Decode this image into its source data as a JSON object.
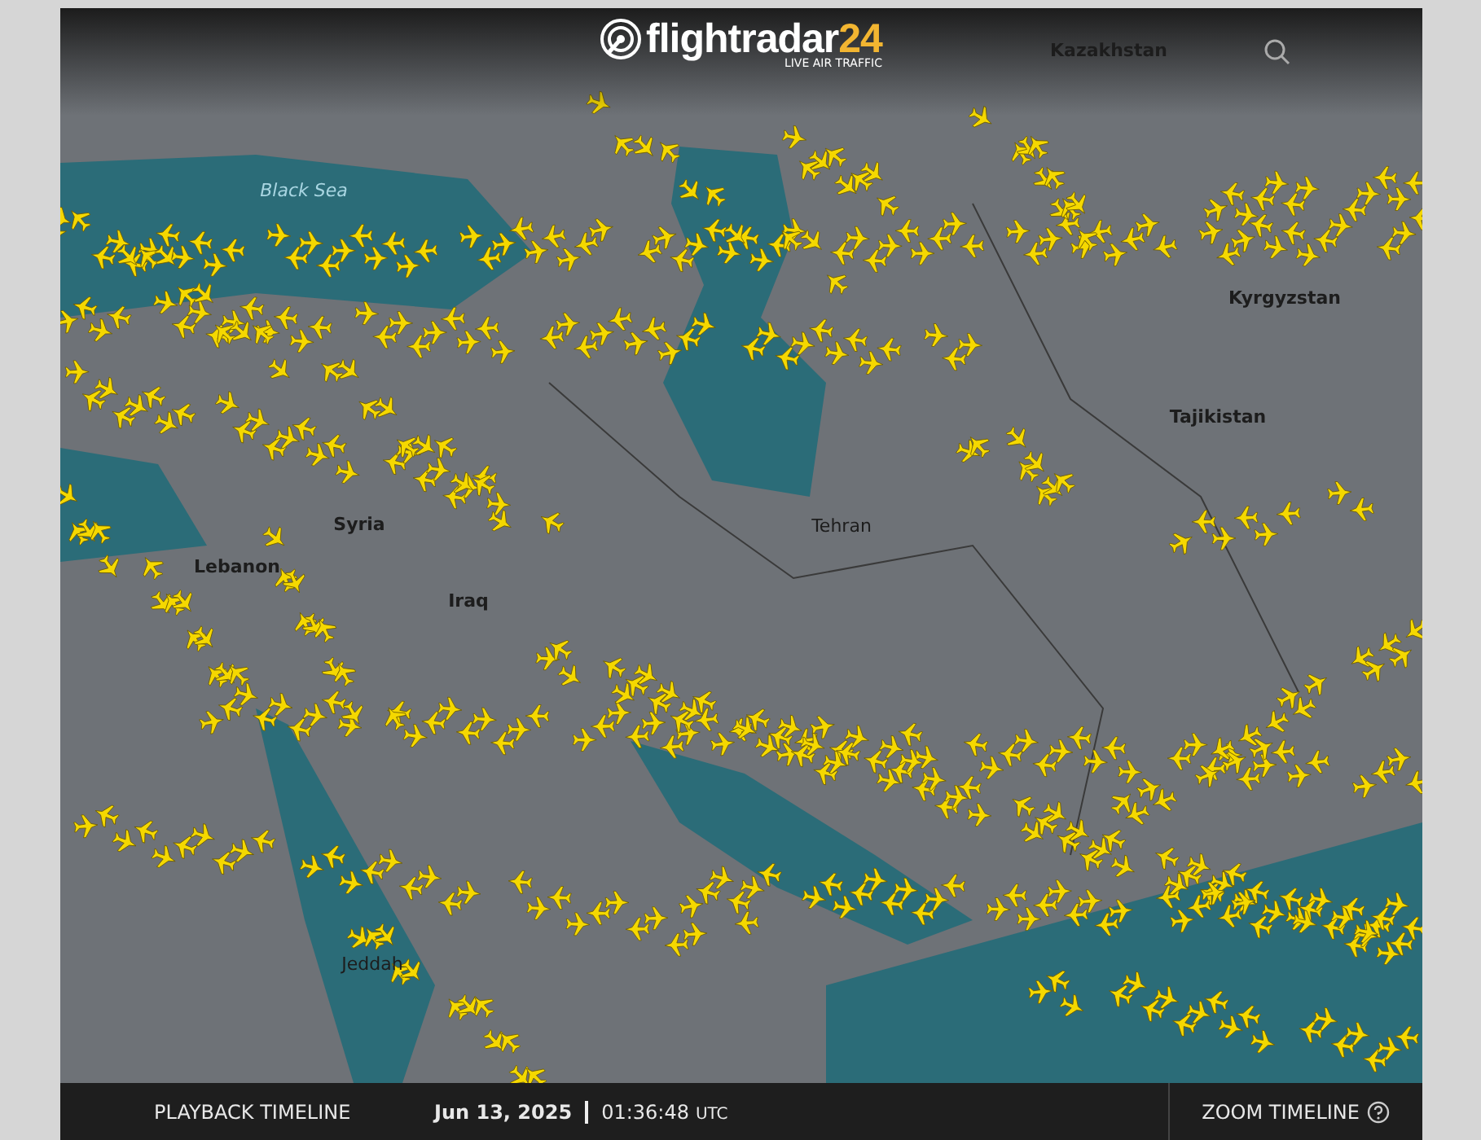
{
  "header": {
    "logo_text": "flightradar",
    "logo_number": "24",
    "tagline": "LIVE AIR TRAFFIC"
  },
  "map_labels": [
    {
      "text": "Kazakhstan",
      "kind": "country"
    },
    {
      "text": "Black Sea",
      "kind": "water"
    },
    {
      "text": "Syria",
      "kind": "country"
    },
    {
      "text": "Lebanon",
      "kind": "country"
    },
    {
      "text": "Iraq",
      "kind": "country"
    },
    {
      "text": "Tehran",
      "kind": "city"
    },
    {
      "text": "Tajikistan",
      "kind": "country"
    },
    {
      "text": "Kyrgyzstan",
      "kind": "country"
    },
    {
      "text": "Jeddah",
      "kind": "city"
    }
  ],
  "timeline": {
    "playback_label": "PLAYBACK TIMELINE",
    "date": "Jun 13, 2025",
    "time": "01:36:48",
    "zone": "UTC",
    "zoom_label": "ZOOM TIMELINE"
  }
}
